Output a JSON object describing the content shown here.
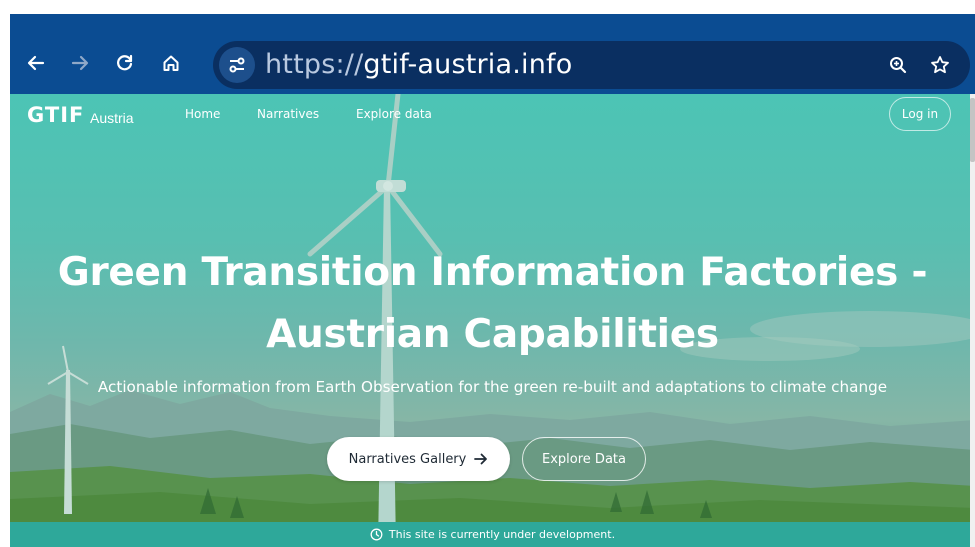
{
  "browser": {
    "url_scheme": "https://",
    "url_host": "gtif-austria.info",
    "icons": [
      "back-arrow-icon",
      "forward-arrow-icon",
      "reload-icon",
      "home-icon",
      "site-settings-icon",
      "zoom-icon",
      "bookmark-star-icon"
    ]
  },
  "site": {
    "logo": "GTIF",
    "logo_sub": "Austria",
    "nav": [
      {
        "label": "Home"
      },
      {
        "label": "Narratives"
      },
      {
        "label": "Explore data"
      }
    ],
    "login_label": "Log in"
  },
  "hero": {
    "title_line1": "Green Transition Information Factories -",
    "title_line2": "Austrian Capabilities",
    "subtitle": "Actionable information from Earth Observation for the green re-built and adaptations to climate change",
    "primary_button": "Narratives Gallery",
    "secondary_button": "Explore Data"
  },
  "banner": {
    "text": "This site is currently under development."
  },
  "colors": {
    "browser_bar": "#0b4c92",
    "address_pill": "#0a2f61",
    "hero_teal": "#4cc4b5",
    "banner": "#2ea89a"
  }
}
